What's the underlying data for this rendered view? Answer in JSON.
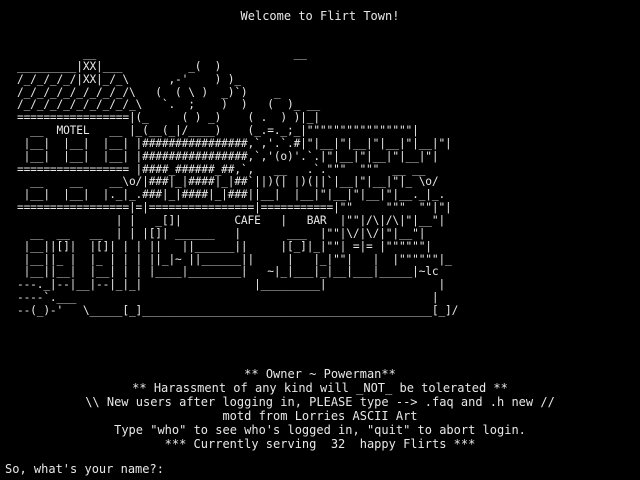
{
  "welcome": "Welcome to Flirt Town!",
  "art": "          __                              __\n_________|XX|___          _(  )\n/_/_/_/_/|XX|_/_\\      ,-'    ) )_\n/_/_/_/_/_/_/_/_/\\   (  ( \\ )  _)`)    _ \n/_/_/_/_/_/_/_/_/_\\   `.  ;    )  )   (  )_ __\n=================|(_     ( ) _)    ( .  ) )|_|\n  __  MOTEL   __ |_(__(_|/____)    (_.=._;_|\"\"\"\"\"\"\"\"\"\"\"\"\"\"\"\"|\n |__|  |__|  |__| |################,`,'.`.#|\"|__|\"|__|\"|__|\"|__|\"|\n |__|  |__|  |__| |################,`,'(o)'.`.|\"|__|\"|__|\"|__|\"|\n================= |####_######_##,`,   __   .`.\"\"\"  \"\"\"  __ __\n  __    __    __\\o/|###|_|####|_|##`||)(| |)(||`|__|\"|__|\"|_ \\o/\n |__|  |__|  |._|_.###|_|####|_|###||__|  |__|\"|__|\"|__|\"|__._|_.\n=================|=|================|===========|\"\"     \"\"\"  \"\"|\"|\n               | |   _[]|        CAFE   |   BAR  |\"\"|/\\|/\\|\"|__\"|\n  __  __   __  | | |[]| ______   |       ___  |\"\"|\\/|\\/|\"|__\"|\n |__||[]|  |[]| | | ||   ||______||     |[_]|_|\"\"| =|= |\"\"\"\"\"\"|\n |__||_ |  |_ | | | ||_|~ ||______||     |   |_|\"\"|   |  |\"\"\"\"\"\"|_\n |__||__|  |__| | | |____|________|   ~|_|___|_|__|___|_____|~lc\n---._|--|__|--|_|_|                 |_________|                 |\n----`.___                                                      |\n--(_)-'   \\_____[_]____________________________________________[_]/",
  "info": {
    "owner": "** Owner ~ Powerman**",
    "harassment": "** Harassment of any kind will _NOT_ be tolerated **",
    "new_users": "\\\\ New users after logging in, PLEASE type --> .faq and .h new //",
    "motd": "motd from Lorries ASCII Art",
    "who": "Type \"who\" to see who's logged in, \"quit\" to abort login.",
    "serving": "*** Currently serving  32  happy Flirts ***"
  },
  "prompt": {
    "label": "So, what's your name?:",
    "value": ""
  }
}
